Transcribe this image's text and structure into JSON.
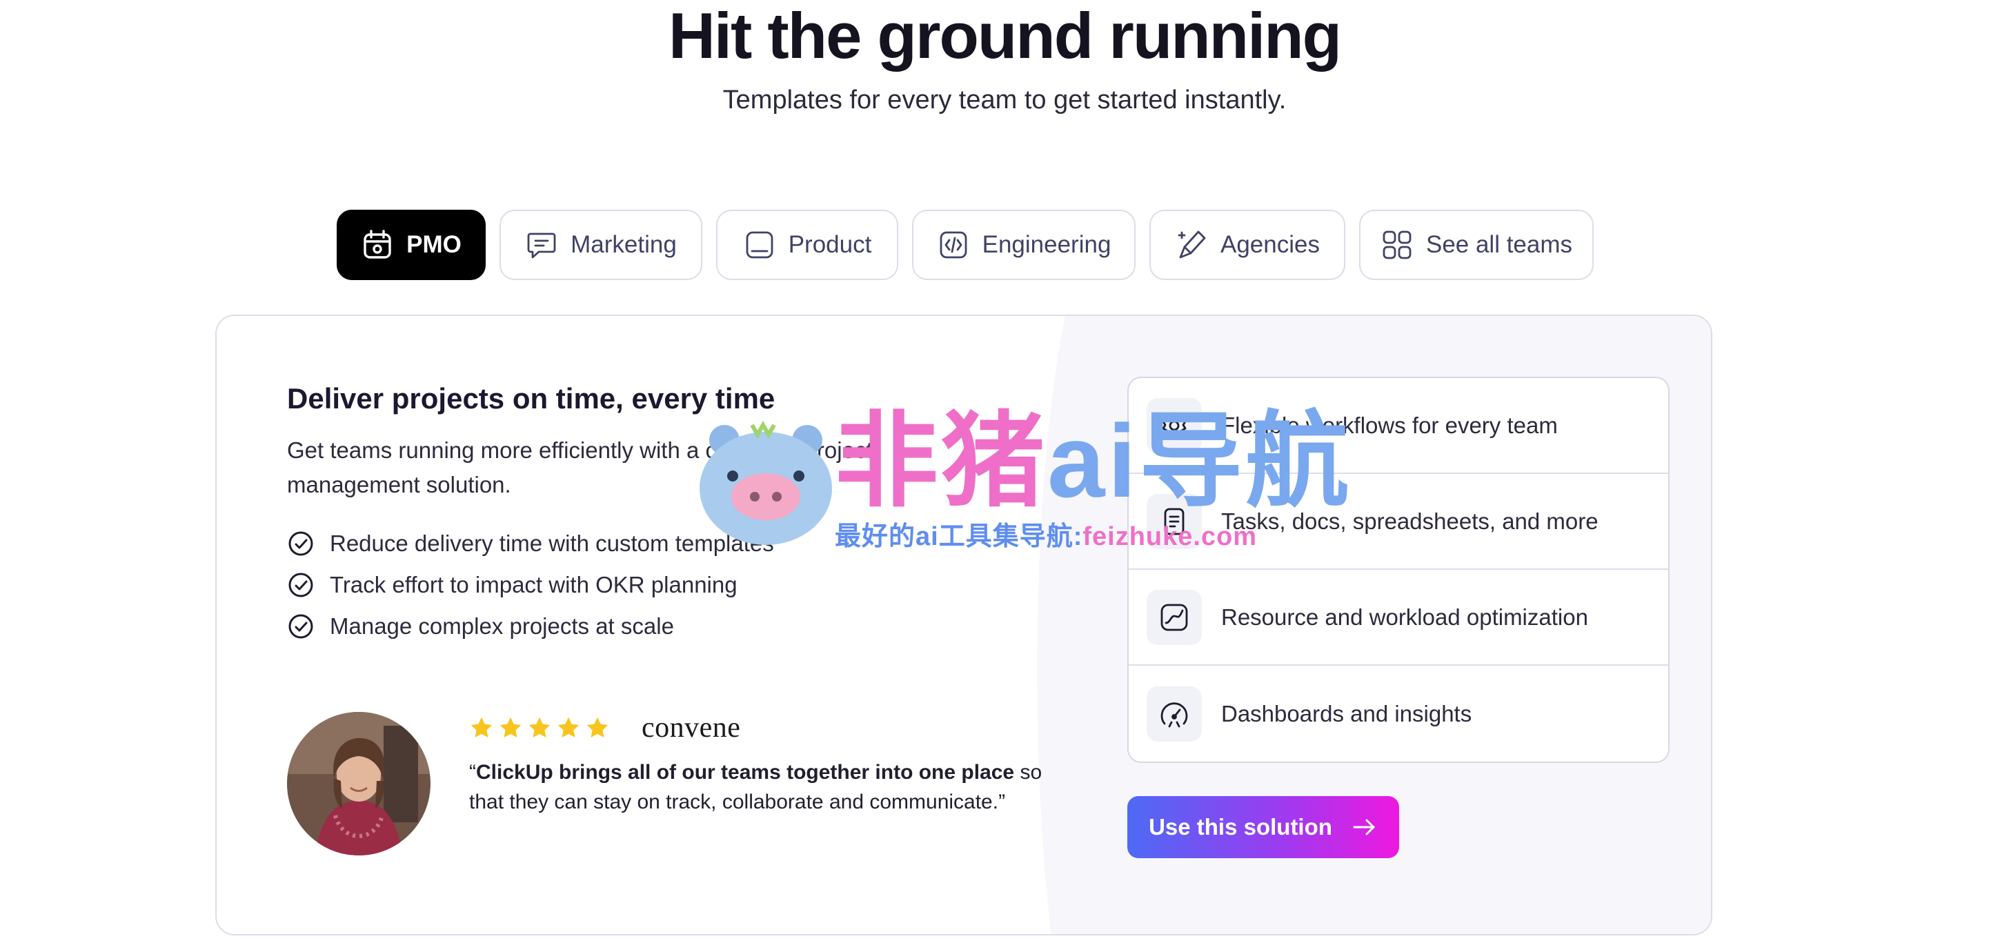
{
  "hero": {
    "title": "Hit the ground running",
    "subtitle": "Templates for every team to get started instantly."
  },
  "tabs": [
    {
      "label": "PMO",
      "icon": "calendar-icon",
      "active": true
    },
    {
      "label": "Marketing",
      "icon": "chat-bubble-icon",
      "active": false
    },
    {
      "label": "Product",
      "icon": "device-icon",
      "active": false
    },
    {
      "label": "Engineering",
      "icon": "code-icon",
      "active": false
    },
    {
      "label": "Agencies",
      "icon": "pen-tool-icon",
      "active": false
    },
    {
      "label": "See all teams",
      "icon": "grid-icon",
      "active": false
    }
  ],
  "solution": {
    "heading": "Deliver projects on time, every time",
    "description": "Get teams running more efficiently with a complete project management solution.",
    "checks": [
      "Reduce delivery time with custom templates",
      "Track effort to impact with OKR planning",
      "Manage complex projects at scale"
    ],
    "review": {
      "rating": 5,
      "brand": "convene",
      "quote_bold": "ClickUp brings all of our teams together into one place",
      "quote_rest": "so that they can stay on track, collaborate and communicate.”",
      "quote_open": "“"
    },
    "features": [
      {
        "label": "Flexible workflows for every team",
        "icon": "gear-icon"
      },
      {
        "label": "Tasks, docs, spreadsheets, and more",
        "icon": "document-icon"
      },
      {
        "label": "Resource and workload optimization",
        "icon": "chart-icon"
      },
      {
        "label": "Dashboards and insights",
        "icon": "gauge-icon"
      }
    ],
    "cta_label": "Use this solution"
  },
  "watermark": {
    "title_pink": "非猪",
    "title_blue": "ai导航",
    "subtitle_blue": "最好的ai工具集导航:",
    "subtitle_pink": "feizhuke.com"
  },
  "colors": {
    "active_tab": "#000000",
    "tab_text": "#3f4264",
    "star": "#f7c51e",
    "cta_start": "#4d6af5",
    "cta_end": "#ee18e0",
    "panel_bg": "#f6f6fb"
  }
}
